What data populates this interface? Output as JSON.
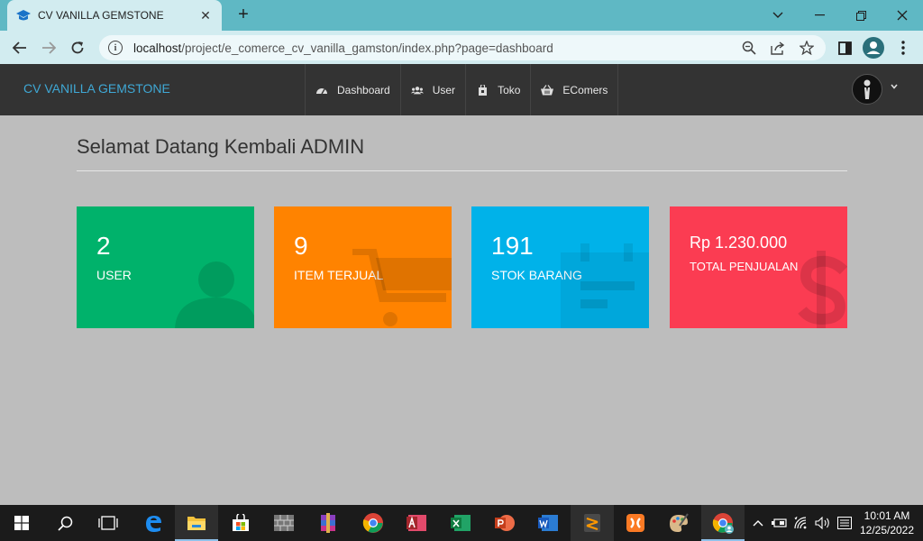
{
  "browser": {
    "tab_title": "CV VANILLA GEMSTONE",
    "url_host": "localhost",
    "url_path": "/project/e_comerce_cv_vanilla_gamston/index.php?page=dashboard"
  },
  "app": {
    "brand": "CV VANILLA GEMSTONE",
    "menu": [
      {
        "label": "Dashboard",
        "icon": "dashboard-icon"
      },
      {
        "label": "User",
        "icon": "users-icon"
      },
      {
        "label": "Toko",
        "icon": "store-icon"
      },
      {
        "label": "EComers",
        "icon": "basket-icon"
      }
    ]
  },
  "content": {
    "heading": "Selamat Datang Kembali ADMIN",
    "cards": [
      {
        "value": "2",
        "label": "USER",
        "color": "#00b26b",
        "icon": "user-icon"
      },
      {
        "value": "9",
        "label": "ITEM TERJUAL",
        "color": "#ff8300",
        "icon": "cart-icon"
      },
      {
        "value": "191",
        "label": "STOK BARANG",
        "color": "#00b2e9",
        "icon": "calendar-icon"
      },
      {
        "value": "Rp 1.230.000",
        "label": "TOTAL PENJUALAN",
        "color": "#fb3c52",
        "icon": "dollar-icon"
      }
    ]
  },
  "taskbar": {
    "time": "10:01 AM",
    "date": "12/25/2022"
  },
  "colors": {
    "tabstrip": "#5fb8c4",
    "toolbar": "#d2ecf0",
    "navbar": "#333333",
    "brand": "#3fa8d5",
    "page_bg": "#bdbdbd"
  }
}
